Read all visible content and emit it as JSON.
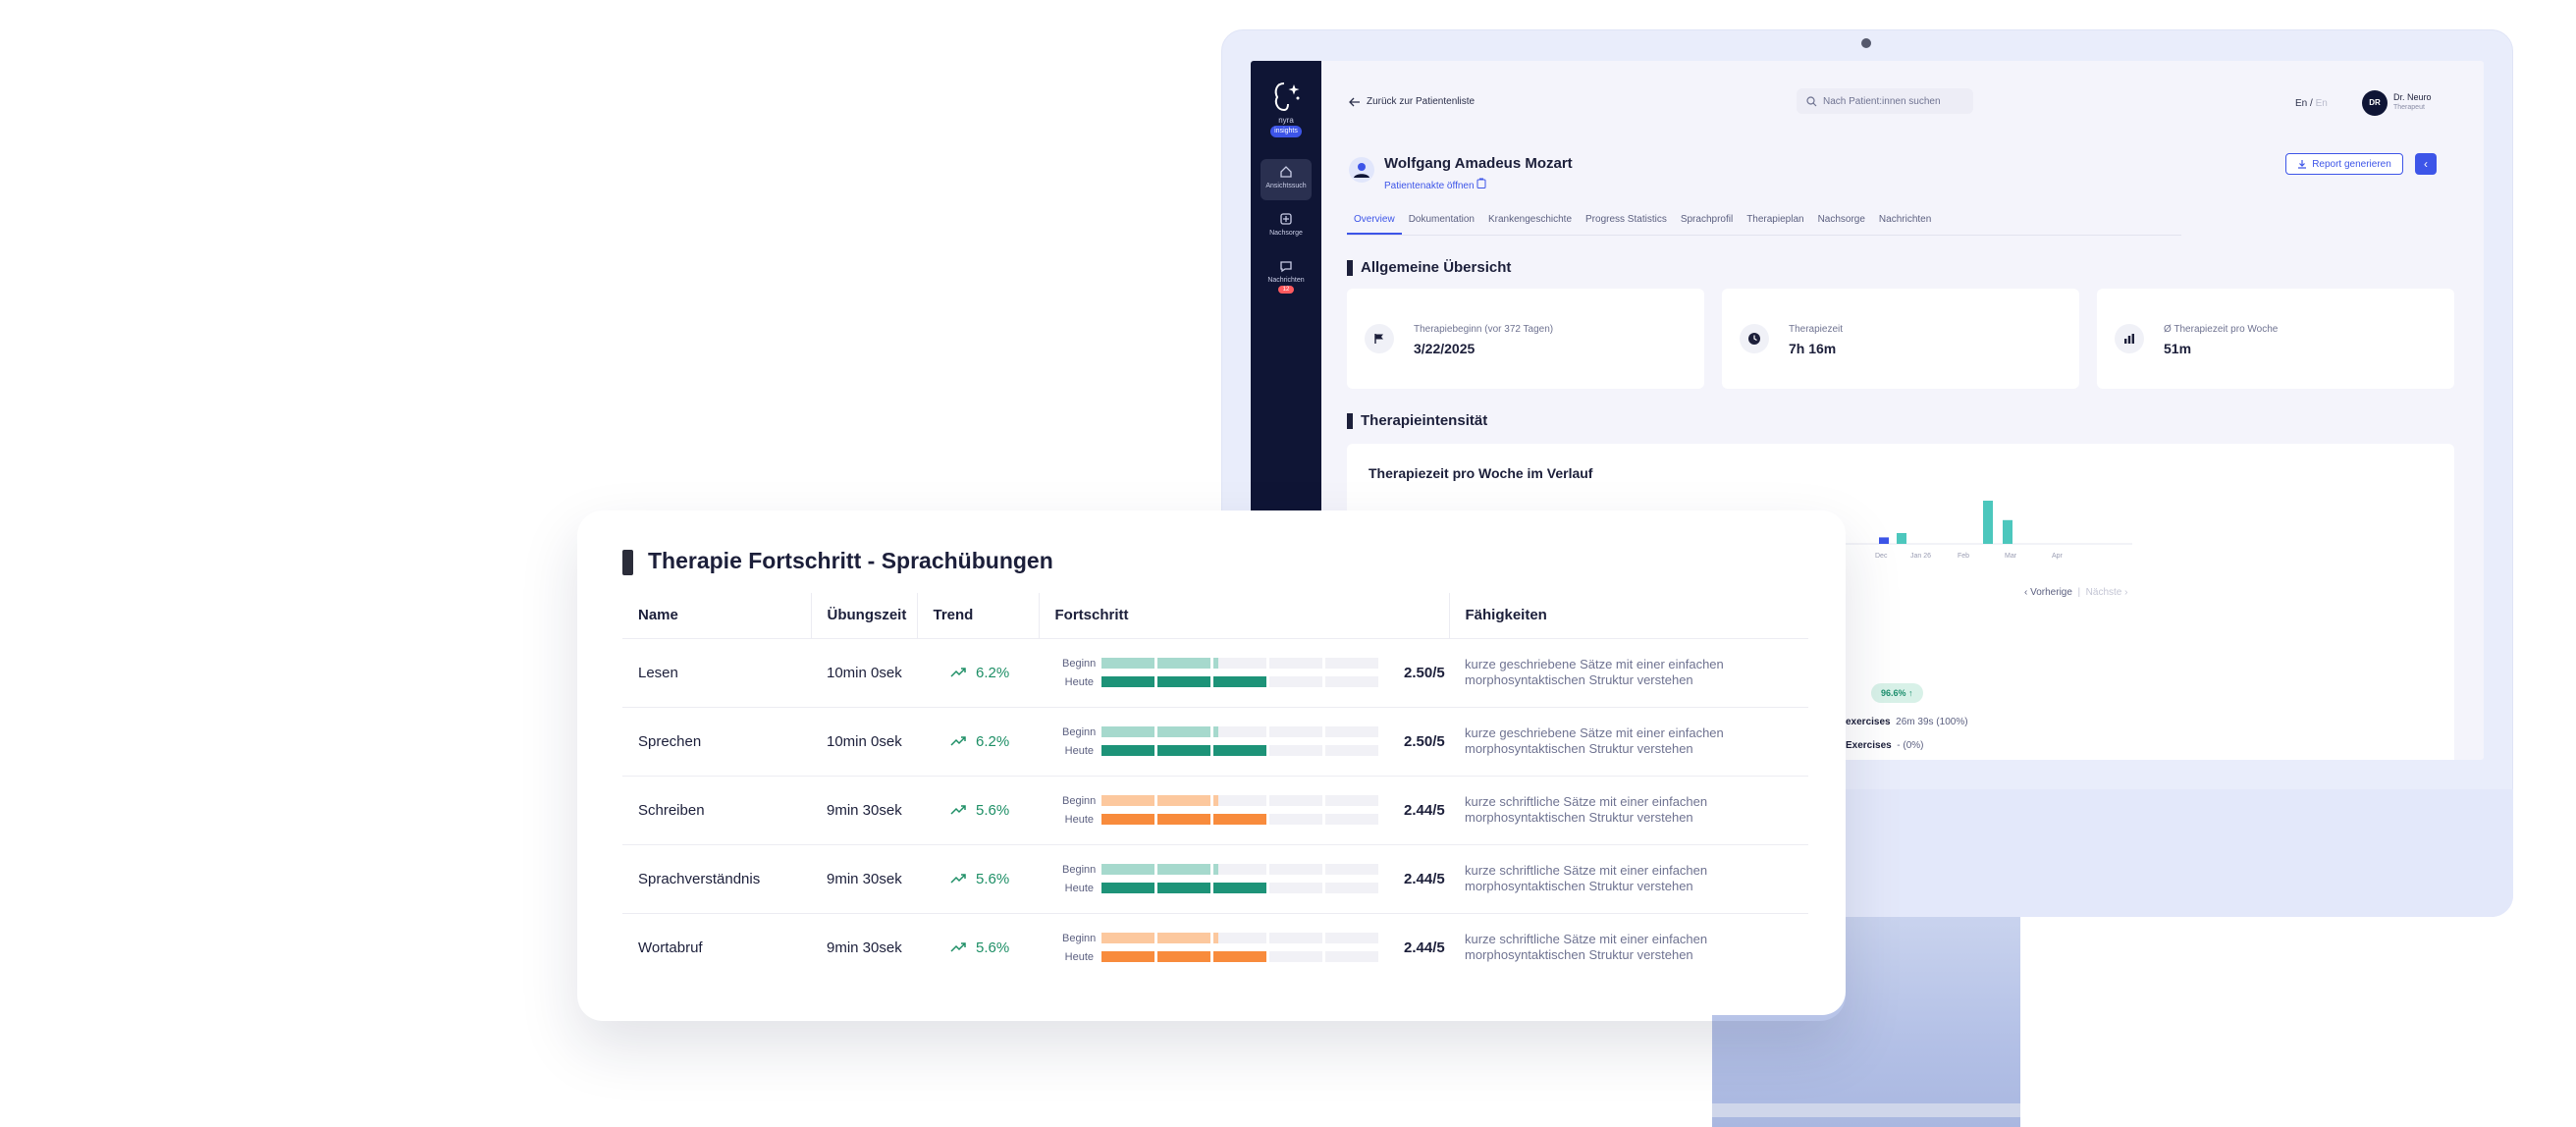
{
  "monitor": {
    "sidebar": {
      "brand_name": "nyra",
      "brand_tag": "insights",
      "items": [
        {
          "label": "Ansichtssuch"
        },
        {
          "label": "Nachsorge"
        },
        {
          "label": "Nachrichten",
          "badge": "12"
        }
      ]
    },
    "topbar": {
      "back_label": "Zurück zur Patientenliste",
      "search_placeholder": "Nach Patient:innen suchen",
      "lang_active": "En",
      "lang_sep": "/",
      "lang_inactive": "En",
      "avatar_initials": "DR",
      "user_name": "Dr. Neuro",
      "user_role": "Therapeut"
    },
    "patient": {
      "name": "Wolfgang Amadeus Mozart",
      "record_link": "Patientenakte öffnen",
      "report_button": "Report generieren",
      "collapse_glyph": "‹"
    },
    "tabs": [
      "Overview",
      "Dokumentation",
      "Krankengeschichte",
      "Progress Statistics",
      "Sprachprofil",
      "Therapieplan",
      "Nachsorge",
      "Nachrichten"
    ],
    "overview_title": "Allgemeine Übersicht",
    "stats": [
      {
        "label": "Therapiebeginn (vor 372 Tagen)",
        "value": "3/22/2025",
        "icon": "flag-icon"
      },
      {
        "label": "Therapiezeit",
        "value": "7h 16m",
        "icon": "clock-icon"
      },
      {
        "label": "Ø Therapiezeit pro Woche",
        "value": "51m",
        "icon": "bar-chart-icon"
      }
    ],
    "intensity_title": "Therapieintensität",
    "chart_title": "Therapiezeit pro Woche im Verlauf",
    "pager": {
      "prev": "Vorherige",
      "next": "Nächste"
    },
    "chip_value": "96.6%",
    "exercise_rows": [
      {
        "label": "exercises",
        "value": "26m 39s (100%)"
      },
      {
        "label": "Exercises",
        "value": "- (0%)"
      }
    ],
    "colors": {
      "accent": "#3d55e8",
      "sidebar": "#0f1535",
      "bar_teal": "#4cc7bd",
      "bar_blue": "#3d55e8"
    }
  },
  "chart_data": {
    "type": "bar",
    "title": "Therapiezeit pro Woche im Verlauf",
    "x_tick_labels": [
      "Dec",
      "Jan 26",
      "Feb",
      "Mar",
      "Apr"
    ],
    "series": [
      {
        "values": [
          3,
          5,
          20,
          11
        ],
        "color": "#4cc7bd"
      },
      {
        "values": [
          3
        ],
        "color": "#3d55e8"
      }
    ],
    "note": "Chart is partially occluded; only a few bars visible"
  },
  "progress_card": {
    "title": "Therapie Fortschritt - Sprachübungen",
    "headers": [
      "Name",
      "Übungszeit",
      "Trend",
      "Fortschritt",
      "Fähigkeiten"
    ],
    "begin_label": "Beginn",
    "today_label": "Heute",
    "colors": {
      "green_light": "#a6d9cd",
      "green_dark": "#1d9378",
      "orange_light": "#fcc89e",
      "orange_dark": "#f88b3c",
      "trend": "#1e8f66"
    },
    "rows": [
      {
        "name": "Lesen",
        "time": "10min 0sek",
        "trend": "6.2%",
        "score": "2.50/5",
        "skill": "kurze geschriebene Sätze mit einer einfachen morphosyntaktischen Struktur verstehen",
        "scheme": "green",
        "begin": 0.42,
        "today": 0.6
      },
      {
        "name": "Sprechen",
        "time": "10min 0sek",
        "trend": "6.2%",
        "score": "2.50/5",
        "skill": "kurze geschriebene Sätze mit einer einfachen morphosyntaktischen Struktur verstehen",
        "scheme": "green",
        "begin": 0.42,
        "today": 0.6
      },
      {
        "name": "Schreiben",
        "time": "9min 30sek",
        "trend": "5.6%",
        "score": "2.44/5",
        "skill": "kurze schriftliche Sätze mit einer einfachen morphosyntaktischen Struktur verstehen",
        "scheme": "orange",
        "begin": 0.42,
        "today": 0.6
      },
      {
        "name": "Sprachverständnis",
        "time": "9min 30sek",
        "trend": "5.6%",
        "score": "2.44/5",
        "skill": "kurze schriftliche Sätze mit einer einfachen morphosyntaktischen Struktur verstehen",
        "scheme": "green",
        "begin": 0.42,
        "today": 0.6
      },
      {
        "name": "Wortabruf",
        "time": "9min 30sek",
        "trend": "5.6%",
        "score": "2.44/5",
        "skill": "kurze schriftliche Sätze mit einer einfachen morphosyntaktischen Struktur verstehen",
        "scheme": "orange",
        "begin": 0.42,
        "today": 0.6
      }
    ]
  }
}
